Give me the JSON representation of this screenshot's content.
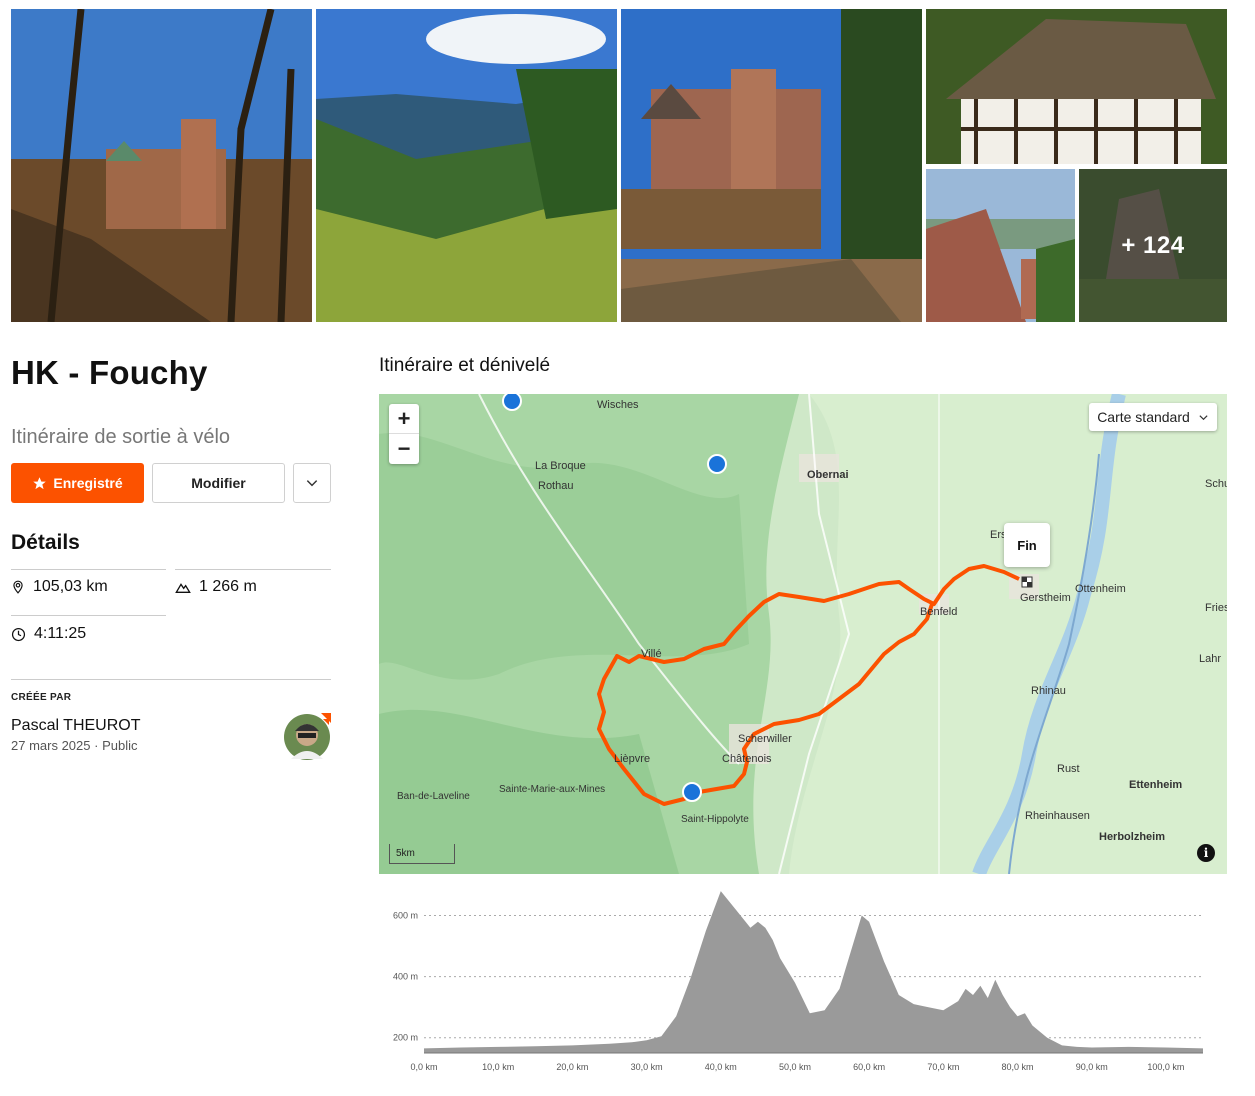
{
  "gallery": {
    "more_count": "+ 124",
    "photos": [
      "castle-forest",
      "valley-meadow",
      "castle-walls",
      "timber-house",
      "castle-view",
      "rock-forest"
    ]
  },
  "route": {
    "title": "HK - Fouchy",
    "subtitle": "Itinéraire de sortie à vélo",
    "save_label": "Enregistré",
    "edit_label": "Modifier"
  },
  "details": {
    "heading": "Détails",
    "distance": "105,03 km",
    "elevation": "1 266 m",
    "time": "4:11:25"
  },
  "creator": {
    "label": "CRÉÉE PAR",
    "name": "Pascal THEUROT",
    "date": "27 mars 2025",
    "visibility": "Public"
  },
  "map": {
    "heading": "Itinéraire et dénivelé",
    "map_type": "Carte standard",
    "scale": "5km",
    "end_label": "Fin",
    "zoom_in": "+",
    "zoom_out": "−",
    "places": [
      "Wisches",
      "La Broque",
      "Rothau",
      "Obernai",
      "Erst",
      "Schutt",
      "Ottenheim",
      "Gerstheim",
      "Benfeld",
      "Friesen",
      "Lahr",
      "Villé",
      "Rhinau",
      "Scherwiller",
      "Châtenois",
      "Rust",
      "Ettenheim",
      "Lièpvre",
      "Ban-de-Laveline",
      "Sainte-Marie-aux-Mines",
      "Saint-Hippolyte",
      "Rheinhausen",
      "Herbolzheim"
    ]
  },
  "chart_data": {
    "type": "area",
    "xlabel": "",
    "ylabel": "",
    "x_ticks": [
      "0,0 km",
      "10,0 km",
      "20,0 km",
      "30,0 km",
      "40,0 km",
      "50,0 km",
      "60,0 km",
      "70,0 km",
      "80,0 km",
      "90,0 km",
      "100,0 km"
    ],
    "y_ticks": [
      "200 m",
      "400 m",
      "600 m"
    ],
    "xlim": [
      0,
      105
    ],
    "ylim": [
      150,
      700
    ],
    "x": [
      0,
      5,
      10,
      15,
      20,
      25,
      28,
      30,
      32,
      34,
      36,
      38,
      40,
      42,
      44,
      45,
      46,
      47,
      48,
      50,
      52,
      54,
      56,
      58,
      59,
      60,
      62,
      64,
      66,
      68,
      70,
      72,
      73,
      74,
      75,
      76,
      77,
      78,
      79,
      80,
      81,
      82,
      84,
      86,
      88,
      90,
      95,
      100,
      105
    ],
    "y": [
      165,
      168,
      170,
      172,
      175,
      180,
      185,
      192,
      205,
      270,
      400,
      550,
      680,
      620,
      560,
      580,
      560,
      520,
      460,
      380,
      280,
      290,
      360,
      520,
      600,
      580,
      450,
      340,
      310,
      300,
      290,
      320,
      360,
      340,
      370,
      330,
      390,
      340,
      300,
      270,
      280,
      240,
      200,
      175,
      170,
      168,
      170,
      168,
      165
    ]
  },
  "colors": {
    "accent": "#fc5200",
    "map_green": "#b5dcb4",
    "water": "#a9cfe8",
    "elevation_fill": "#9a9a9a"
  }
}
